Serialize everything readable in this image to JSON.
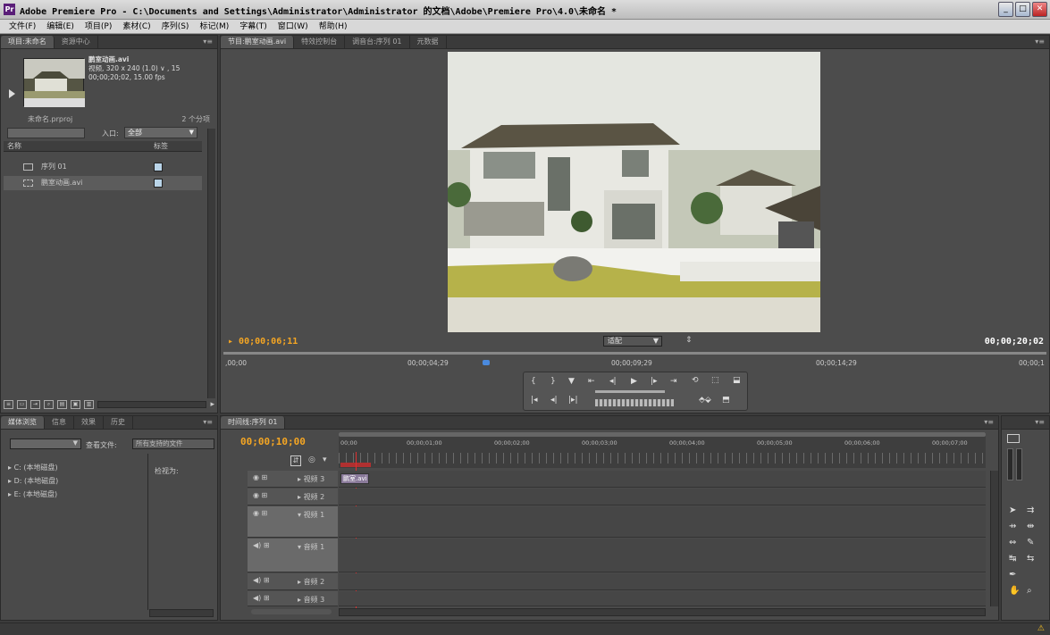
{
  "window": {
    "title": "Adobe Premiere Pro - C:\\Documents and Settings\\Administrator\\Administrator 的文档\\Adobe\\Premiere Pro\\4.0\\未命名 *",
    "app_icon": "Pr"
  },
  "menu": [
    "文件(F)",
    "编辑(E)",
    "项目(P)",
    "素材(C)",
    "序列(S)",
    "标记(M)",
    "字幕(T)",
    "窗口(W)",
    "帮助(H)"
  ],
  "project_panel": {
    "tabs": [
      "项目:未命名",
      "资源中心"
    ],
    "clip_name": "鹏室动画.avi",
    "clip_info_line1": "视频, 320 x 240 (1.0) ∨ , 15",
    "clip_info_line2": "00;00;20;02, 15.00 fps",
    "project_name": "未命名.prproj",
    "item_count": "2 个分项",
    "search_placeholder": "",
    "search_prefix": "",
    "entry_label": "入口:",
    "entry_value": "全部",
    "col_name": "名称",
    "col_label": "标签",
    "items": [
      {
        "name": "序列 01",
        "type": "sequence"
      },
      {
        "name": "鹏室动画.avi",
        "type": "clip"
      }
    ]
  },
  "program_monitor": {
    "tabs": [
      "节目:鹏室动画.avi",
      "特效控制台",
      "调音台:序列 01",
      "元数据"
    ],
    "timecode_current": "00;00;06;11",
    "timecode_duration": "00;00;20;02",
    "fit_value": "适配",
    "ruler_labels": [
      ",00;00",
      "00;00;04;29",
      "00;00;09;29",
      "00;00;14;29",
      "00;00;1"
    ]
  },
  "effects_panel": {
    "tabs": [
      "媒体浏览",
      "信息",
      "效果",
      "历史"
    ],
    "filetype_label": "查看文件:",
    "filetype_value": "所有支持的文件",
    "view_label": "检视为:",
    "drives": [
      "C: (本地磁盘)",
      "D: (本地磁盘)",
      "E: (本地磁盘)"
    ]
  },
  "timeline": {
    "tab": "时间线:序列 01",
    "timecode": "00;00;10;00",
    "ruler_labels": [
      "00;00",
      "00;00;01;00",
      "00;00;02;00",
      "00;00;03;00",
      "00;00;04;00",
      "00;00;05;00",
      "00;00;06;00",
      "00;00;07;00"
    ],
    "tracks": [
      {
        "label": "视频 3",
        "kind": "video"
      },
      {
        "label": "视频 2",
        "kind": "video"
      },
      {
        "label": "视频 1",
        "kind": "video"
      },
      {
        "label": "音频 1",
        "kind": "audio"
      },
      {
        "label": "音频 2",
        "kind": "audio"
      },
      {
        "label": "音频 3",
        "kind": "audio"
      }
    ],
    "clip_label": "鹏室.avi"
  },
  "colors": {
    "timecode_accent": "#f5a623",
    "playhead": "#e03030"
  }
}
